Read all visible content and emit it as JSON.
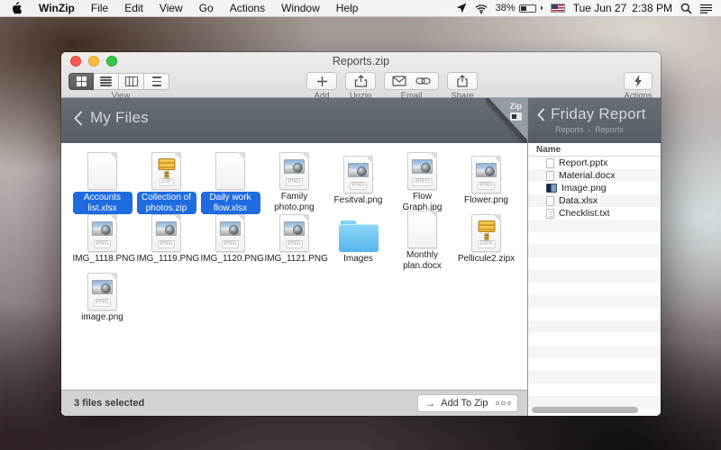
{
  "menu_bar": {
    "app_name": "WinZip",
    "menus": [
      "File",
      "Edit",
      "View",
      "Go",
      "Actions",
      "Window",
      "Help"
    ],
    "battery_percent": "38%",
    "date": "Tue Jun 27",
    "time": "2:38 PM"
  },
  "window": {
    "title": "Reports.zip",
    "toolbar": {
      "view": "View",
      "add": "Add",
      "unzip": "Unzip",
      "email": "Email",
      "share": "Share",
      "actions": "Actions"
    },
    "left_pane": {
      "title": "My Files",
      "corner_badge": "Zip",
      "status": "3 files selected",
      "add_to_zip": "Add To Zip",
      "files": [
        {
          "name": "Accounts list.xlsx",
          "type": "doc",
          "selected": true
        },
        {
          "name": "Collection of photos.zip",
          "type": "zip",
          "selected": true
        },
        {
          "name": "Daily work flow.xlsx",
          "type": "doc",
          "selected": true
        },
        {
          "name": "Family photo.png",
          "type": "png",
          "selected": false
        },
        {
          "name": "Fesitval.png",
          "type": "png",
          "selected": false
        },
        {
          "name": "Flow Graph.jpg",
          "type": "jpeg",
          "selected": false
        },
        {
          "name": "Flower.png",
          "type": "png",
          "selected": false
        },
        {
          "name": "IMG_1118.PNG",
          "type": "png",
          "selected": false
        },
        {
          "name": "IMG_1119.PNG",
          "type": "png",
          "selected": false
        },
        {
          "name": "IMG_1120.PNG",
          "type": "png",
          "selected": false
        },
        {
          "name": "IMG_1121.PNG",
          "type": "png",
          "selected": false
        },
        {
          "name": "Images",
          "type": "folder",
          "selected": false
        },
        {
          "name": "Monthly plan.docx",
          "type": "doc",
          "selected": false
        },
        {
          "name": "Pellicule2.zipx",
          "type": "zipx",
          "selected": false
        },
        {
          "name": "image.png",
          "type": "png",
          "selected": false
        }
      ],
      "icon_tags": {
        "png": "PNG",
        "jpeg": "JPEG",
        "zip": "ZIP",
        "zipx": "ZIPX"
      }
    },
    "right_pane": {
      "title": "Friday Report",
      "breadcrumb": [
        "Reports",
        "Reports"
      ],
      "column_name": "Name",
      "files": [
        {
          "name": "Report.pptx",
          "type": "doc"
        },
        {
          "name": "Material.docx",
          "type": "doc"
        },
        {
          "name": "Image.png",
          "type": "image"
        },
        {
          "name": "Data.xlsx",
          "type": "doc"
        },
        {
          "name": "Checklist.txt",
          "type": "text"
        }
      ]
    }
  },
  "colors": {
    "selection_blue": "#1f6be0",
    "header_gray": "#5f656c",
    "folder_blue": "#55b5ec",
    "toolbar_gray": "#e2e2e2"
  }
}
